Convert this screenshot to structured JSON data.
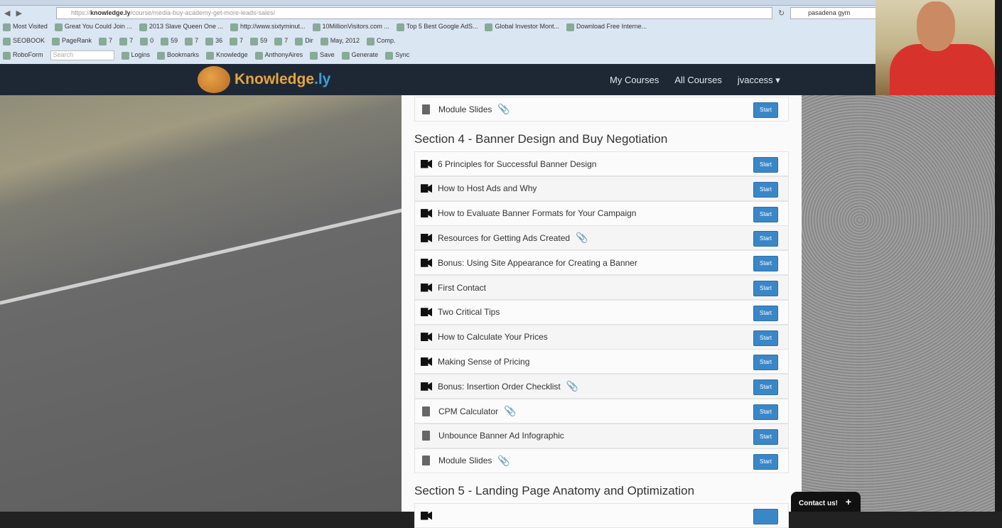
{
  "browser": {
    "url_prefix": "https://",
    "url_domain": "knowledge.ly",
    "url_path": "/course/media-buy-academy-get-more-leads-sales/",
    "search_value": "pasadena gym",
    "bookmarks": [
      "Most Visited",
      "Great You Could Join ...",
      "2013 Slave Queen One ...",
      "http://www.sixtyminut...",
      "10MillionVisitors.com ...",
      "Top 5 Best Google AdS...",
      "Global Investor Mont...",
      "Download Free Interne..."
    ],
    "toolbar": [
      "SEOBOOK",
      "PageRank",
      "7",
      "7",
      "0",
      "59",
      "7",
      "36",
      "7",
      "59",
      "7",
      "Dir",
      "May, 2012",
      "Comp."
    ],
    "roboform": [
      "RoboForm",
      "Logins",
      "Bookmarks",
      "Knowledge",
      "AnthonyAires",
      "Save",
      "Generate",
      "Sync"
    ],
    "roboform_search_placeholder": "Search"
  },
  "site": {
    "logo_main": "Knowledge",
    "logo_suffix": ".ly",
    "nav": [
      "My Courses",
      "All Courses",
      "jvaccess ▾"
    ]
  },
  "course": {
    "prev_item": {
      "title": "Module Slides",
      "type": "doc",
      "attachment": true
    },
    "section4_title": "Section 4 - Banner Design and Buy Negotiation",
    "section4_items": [
      {
        "title": "6 Principles for Successful Banner Design",
        "type": "video",
        "attachment": false
      },
      {
        "title": "How to Host Ads and Why",
        "type": "video",
        "attachment": false
      },
      {
        "title": "How to Evaluate Banner Formats for Your Campaign",
        "type": "video",
        "attachment": false
      },
      {
        "title": "Resources for Getting Ads Created",
        "type": "video",
        "attachment": true
      },
      {
        "title": "Bonus: Using Site Appearance for Creating a Banner",
        "type": "video",
        "attachment": false
      },
      {
        "title": "First Contact",
        "type": "video",
        "attachment": false
      },
      {
        "title": "Two Critical Tips",
        "type": "video",
        "attachment": false
      },
      {
        "title": "How to Calculate Your Prices",
        "type": "video",
        "attachment": false
      },
      {
        "title": "Making Sense of Pricing",
        "type": "video",
        "attachment": false
      },
      {
        "title": "Bonus: Insertion Order Checklist",
        "type": "video",
        "attachment": true
      },
      {
        "title": "CPM Calculator",
        "type": "doc",
        "attachment": true
      },
      {
        "title": "Unbounce Banner Ad Infographic",
        "type": "doc",
        "attachment": false
      },
      {
        "title": "Module Slides",
        "type": "doc",
        "attachment": true
      }
    ],
    "section5_title": "Section 5 - Landing Page Anatomy and Optimization",
    "start_label": "Start"
  },
  "contact": {
    "label": "Contact us!",
    "icon": "+"
  }
}
